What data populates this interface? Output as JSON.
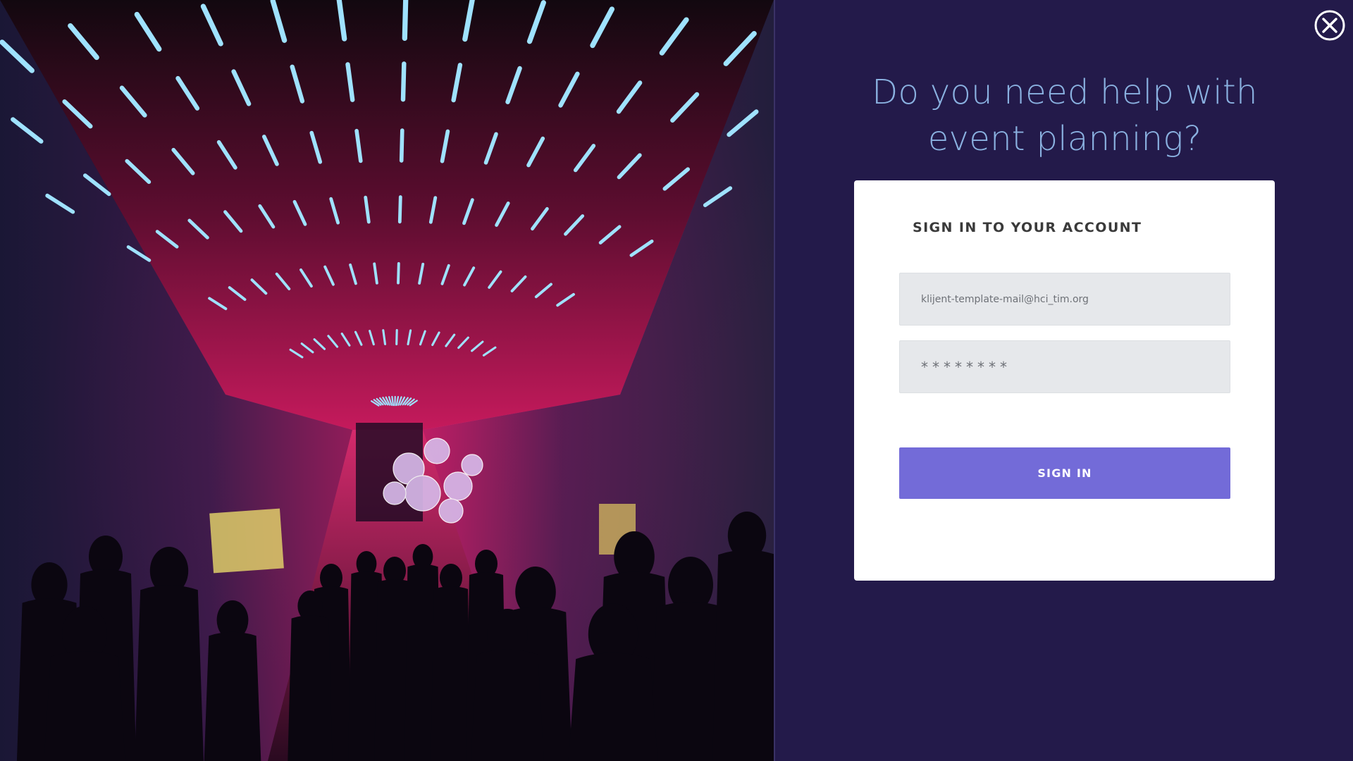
{
  "panel": {
    "headline_line1": "Do you need help with",
    "headline_line2": "event planning?",
    "background_color": "#231a4a"
  },
  "close_button": {
    "icon": "close-icon"
  },
  "login": {
    "title": "SIGN IN TO YOUR ACCOUNT",
    "email_value": "klijent-template-mail@hci_tim.org",
    "password_value": "********",
    "submit_label": "SIGN IN",
    "accent_color": "#736bd8"
  },
  "photo": {
    "subject": "nightclub-party-photo"
  }
}
